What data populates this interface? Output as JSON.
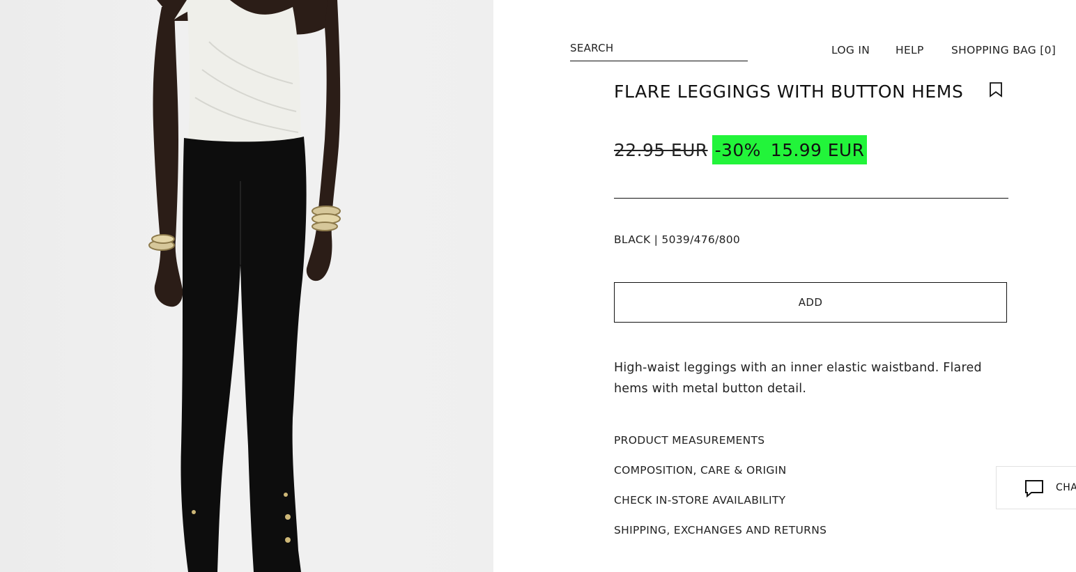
{
  "header": {
    "search_placeholder": "SEARCH",
    "login": "LOG IN",
    "help": "HELP",
    "shopping_bag": "SHOPPING BAG [0]"
  },
  "product": {
    "title": "FLARE LEGGINGS WITH BUTTON HEMS",
    "old_price": "22.95 EUR",
    "discount": "-30%",
    "sale_price": "15.99 EUR",
    "color_reference": "BLACK | 5039/476/800",
    "add_label": "ADD",
    "description": "High-waist leggings with an inner elastic waistband. Flared hems with metal button detail.",
    "info_links": [
      "PRODUCT MEASUREMENTS",
      "COMPOSITION, CARE & ORIGIN",
      "CHECK IN-STORE AVAILABILITY",
      "SHIPPING, EXCHANGES AND RETURNS"
    ]
  },
  "chat": {
    "label": "CHA"
  },
  "colors": {
    "sale_highlight": "#22f43a",
    "text": "#111111",
    "photo_background": "#efefef"
  },
  "icons": {
    "bookmark": "bookmark-icon",
    "chat": "chat-bubble-icon"
  }
}
